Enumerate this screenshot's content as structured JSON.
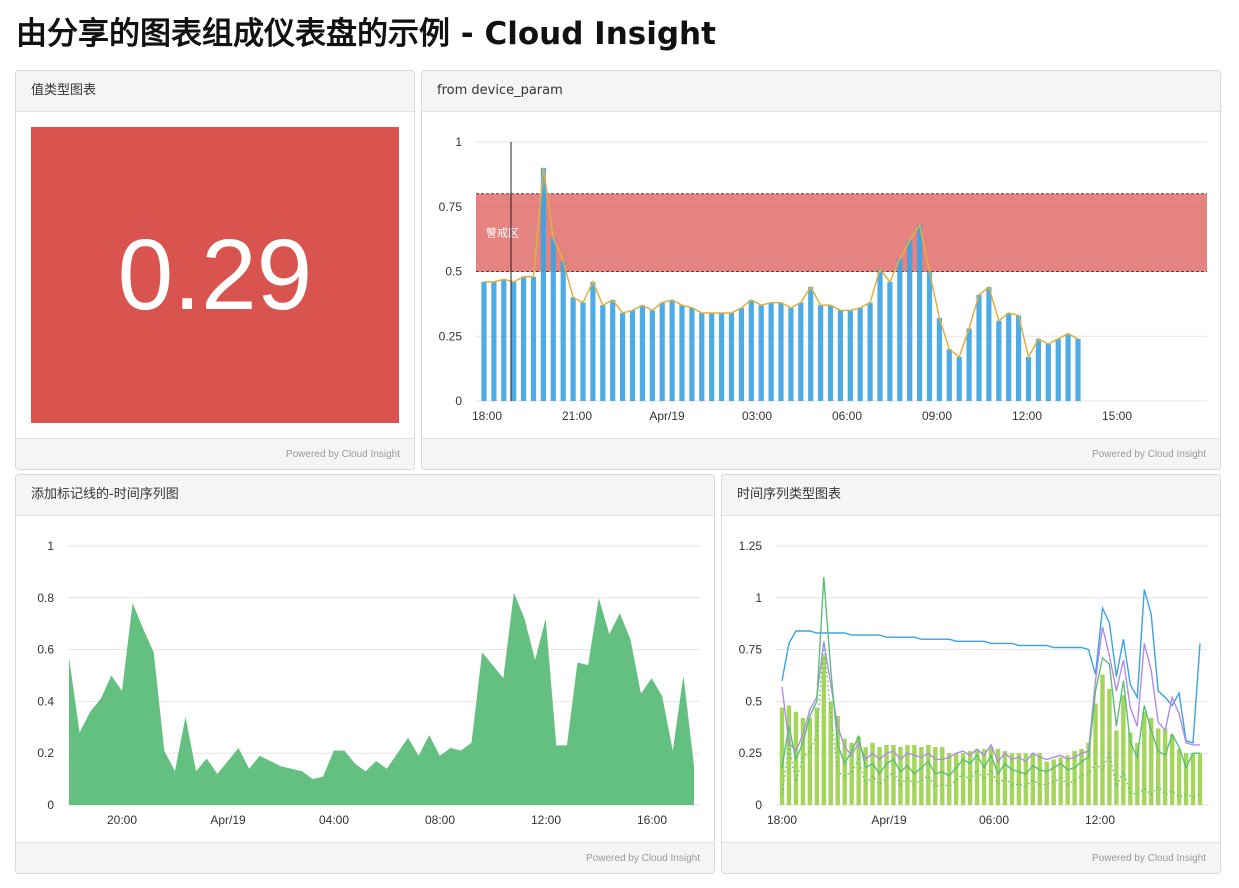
{
  "page": {
    "title": "由分享的图表组成仪表盘的示例 - Cloud Insight"
  },
  "footer_text": "Powered by Cloud Insight",
  "value_panel": {
    "title": "值类型图表",
    "value": "0.29",
    "color": "#d9534f"
  },
  "bar_panel": {
    "title": "from device_param",
    "chart_data": {
      "type": "bar",
      "ylim": [
        0,
        1
      ],
      "yticks": [
        "1",
        "0.75",
        "0.5",
        "0.25",
        "0"
      ],
      "x_labels": [
        "18:00",
        "21:00",
        "Apr/19",
        "03:00",
        "06:00",
        "09:00",
        "12:00",
        "15:00"
      ],
      "warning_band": {
        "label": "警戒区",
        "from": 0.5,
        "to": 0.8,
        "color": "#d9534f"
      },
      "bar_color": "#3aa3e3",
      "line_color": "#e0b040",
      "values": [
        0.46,
        0.46,
        0.47,
        0.46,
        0.48,
        0.48,
        0.9,
        0.63,
        0.54,
        0.4,
        0.38,
        0.46,
        0.37,
        0.39,
        0.34,
        0.35,
        0.37,
        0.35,
        0.38,
        0.39,
        0.37,
        0.36,
        0.34,
        0.34,
        0.34,
        0.34,
        0.36,
        0.39,
        0.37,
        0.38,
        0.38,
        0.36,
        0.38,
        0.44,
        0.37,
        0.37,
        0.35,
        0.35,
        0.36,
        0.38,
        0.51,
        0.46,
        0.55,
        0.62,
        0.68,
        0.5,
        0.32,
        0.2,
        0.17,
        0.28,
        0.41,
        0.44,
        0.31,
        0.34,
        0.33,
        0.17,
        0.24,
        0.22,
        0.24,
        0.26,
        0.24
      ]
    }
  },
  "area_panel": {
    "title": "添加标记线的-时间序列图",
    "chart_data": {
      "type": "area",
      "ylim": [
        0,
        1
      ],
      "yticks": [
        "1",
        "0.8",
        "0.6",
        "0.4",
        "0.2",
        "0"
      ],
      "x_labels": [
        "20:00",
        "Apr/19",
        "04:00",
        "08:00",
        "12:00",
        "16:00"
      ],
      "color": "#5cbd7a",
      "values": [
        0.57,
        0.28,
        0.36,
        0.41,
        0.5,
        0.44,
        0.78,
        0.68,
        0.59,
        0.21,
        0.13,
        0.34,
        0.13,
        0.18,
        0.12,
        0.17,
        0.22,
        0.14,
        0.19,
        0.17,
        0.15,
        0.14,
        0.13,
        0.1,
        0.11,
        0.21,
        0.21,
        0.16,
        0.13,
        0.17,
        0.14,
        0.2,
        0.26,
        0.19,
        0.27,
        0.19,
        0.22,
        0.21,
        0.24,
        0.59,
        0.54,
        0.49,
        0.82,
        0.72,
        0.56,
        0.72,
        0.23,
        0.23,
        0.55,
        0.54,
        0.8,
        0.66,
        0.74,
        0.64,
        0.43,
        0.49,
        0.42,
        0.21,
        0.5,
        0.15
      ]
    }
  },
  "multi_panel": {
    "title": "时间序列类型图表",
    "chart_data": {
      "type": "line",
      "ylim": [
        0,
        1.25
      ],
      "yticks": [
        "1.25",
        "1",
        "0.75",
        "0.5",
        "0.25",
        "0"
      ],
      "x_labels": [
        "18:00",
        "Apr/19",
        "06:00",
        "12:00"
      ],
      "series": [
        {
          "color": "#3aa3e3",
          "values": [
            0.6,
            0.78,
            0.84,
            0.84,
            0.84,
            0.83,
            0.83,
            0.83,
            0.83,
            0.83,
            0.82,
            0.82,
            0.82,
            0.82,
            0.82,
            0.81,
            0.81,
            0.81,
            0.81,
            0.81,
            0.8,
            0.8,
            0.8,
            0.8,
            0.8,
            0.79,
            0.79,
            0.79,
            0.79,
            0.79,
            0.78,
            0.78,
            0.78,
            0.78,
            0.77,
            0.77,
            0.77,
            0.77,
            0.77,
            0.76,
            0.76,
            0.76,
            0.76,
            0.76,
            0.75,
            0.63,
            0.95,
            0.88,
            0.62,
            0.8,
            0.58,
            0.52,
            1.04,
            0.92,
            0.55,
            0.52,
            0.48,
            0.54,
            0.31,
            0.3,
            0.78
          ]
        },
        {
          "color": "#b38be8",
          "values": [
            0.57,
            0.3,
            0.26,
            0.34,
            0.46,
            0.52,
            0.79,
            0.58,
            0.38,
            0.28,
            0.24,
            0.3,
            0.22,
            0.25,
            0.22,
            0.25,
            0.26,
            0.22,
            0.25,
            0.24,
            0.23,
            0.25,
            0.22,
            0.22,
            0.23,
            0.25,
            0.26,
            0.24,
            0.27,
            0.24,
            0.29,
            0.21,
            0.25,
            0.22,
            0.23,
            0.21,
            0.25,
            0.23,
            0.22,
            0.23,
            0.24,
            0.22,
            0.23,
            0.25,
            0.26,
            0.6,
            0.86,
            0.72,
            0.55,
            0.7,
            0.47,
            0.38,
            0.78,
            0.65,
            0.4,
            0.36,
            0.52,
            0.44,
            0.3,
            0.29,
            0.29
          ]
        },
        {
          "color": "#5cbd7a",
          "values": [
            0.18,
            0.38,
            0.22,
            0.3,
            0.43,
            0.5,
            1.1,
            0.65,
            0.29,
            0.2,
            0.26,
            0.33,
            0.18,
            0.2,
            0.15,
            0.2,
            0.22,
            0.16,
            0.19,
            0.15,
            0.18,
            0.21,
            0.15,
            0.16,
            0.14,
            0.18,
            0.22,
            0.2,
            0.24,
            0.18,
            0.24,
            0.15,
            0.2,
            0.17,
            0.16,
            0.15,
            0.19,
            0.17,
            0.16,
            0.18,
            0.2,
            0.17,
            0.18,
            0.21,
            0.23,
            0.55,
            0.71,
            0.68,
            0.38,
            0.6,
            0.3,
            0.23,
            0.48,
            0.36,
            0.26,
            0.24,
            0.34,
            0.28,
            0.18,
            0.25,
            0.25
          ]
        },
        {
          "color": "#5cbd7a",
          "style": "dotted",
          "values": [
            0.05,
            0.29,
            0.11,
            0.23,
            0.26,
            0.34,
            0.78,
            0.44,
            0.16,
            0.14,
            0.16,
            0.22,
            0.1,
            0.14,
            0.1,
            0.13,
            0.16,
            0.1,
            0.13,
            0.1,
            0.12,
            0.14,
            0.09,
            0.1,
            0.09,
            0.12,
            0.15,
            0.12,
            0.17,
            0.12,
            0.17,
            0.1,
            0.13,
            0.1,
            0.1,
            0.09,
            0.12,
            0.1,
            0.1,
            0.11,
            0.13,
            0.1,
            0.12,
            0.14,
            0.15,
            0.2,
            0.17,
            0.25,
            0.09,
            0.16,
            0.06,
            0.05,
            0.08,
            0.05,
            0.09,
            0.05,
            0.07,
            0.04,
            0.05,
            0.04,
            0.05
          ]
        }
      ],
      "bars": {
        "color": "#a3d65b",
        "values": [
          0.47,
          0.48,
          0.45,
          0.42,
          0.42,
          0.47,
          0.72,
          0.5,
          0.43,
          0.32,
          0.3,
          0.33,
          0.28,
          0.3,
          0.28,
          0.29,
          0.29,
          0.28,
          0.29,
          0.29,
          0.28,
          0.29,
          0.28,
          0.28,
          0.25,
          0.25,
          0.25,
          0.26,
          0.27,
          0.27,
          0.28,
          0.27,
          0.26,
          0.25,
          0.25,
          0.25,
          0.25,
          0.25,
          0.21,
          0.22,
          0.23,
          0.24,
          0.26,
          0.27,
          0.3,
          0.49,
          0.63,
          0.56,
          0.36,
          0.53,
          0.35,
          0.3,
          0.45,
          0.42,
          0.37,
          0.37,
          0.34,
          0.27,
          0.25,
          0.25,
          0.25
        ]
      }
    }
  }
}
